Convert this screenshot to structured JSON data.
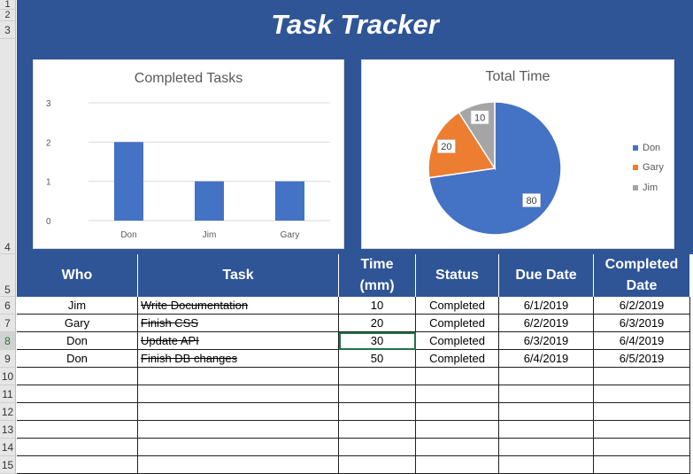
{
  "title": "Task Tracker",
  "row_numbers": [
    "1",
    "2",
    "3",
    "4",
    "5",
    "6",
    "7",
    "8",
    "9",
    "10",
    "11",
    "12",
    "13",
    "14",
    "15"
  ],
  "colors": {
    "banner": "#2f5597",
    "bar": "#4472c4",
    "don": "#4472c4",
    "gary": "#ed7d31",
    "jim": "#a5a5a5",
    "active_cell": "#217346"
  },
  "chart_data": [
    {
      "type": "bar",
      "title": "Completed Tasks",
      "categories": [
        "Don",
        "Jim",
        "Gary"
      ],
      "values": [
        2,
        1,
        1
      ],
      "ylim": [
        0,
        3
      ],
      "yticks": [
        "0",
        "1",
        "2",
        "3"
      ],
      "grid": true,
      "legend": "none"
    },
    {
      "type": "pie",
      "title": "Total Time",
      "labels": [
        "Don",
        "Gary",
        "Jim"
      ],
      "values": [
        80,
        20,
        10
      ],
      "data_labels": [
        "80",
        "20",
        "10"
      ],
      "legend": "right"
    }
  ],
  "table": {
    "headers": [
      "Who",
      "Task",
      "Time (mm)",
      "Status",
      "Due Date",
      "Completed Date"
    ],
    "rows": [
      [
        "Jim",
        "Write Documentation",
        "10",
        "Completed",
        "6/1/2019",
        "6/2/2019"
      ],
      [
        "Gary",
        "Finish CSS",
        "20",
        "Completed",
        "6/2/2019",
        "6/3/2019"
      ],
      [
        "Don",
        "Update API",
        "30",
        "Completed",
        "6/3/2019",
        "6/4/2019"
      ],
      [
        "Don",
        "Finish DB changes",
        "50",
        "Completed",
        "6/4/2019",
        "6/5/2019"
      ]
    ],
    "active_cell": "Time row 8"
  }
}
